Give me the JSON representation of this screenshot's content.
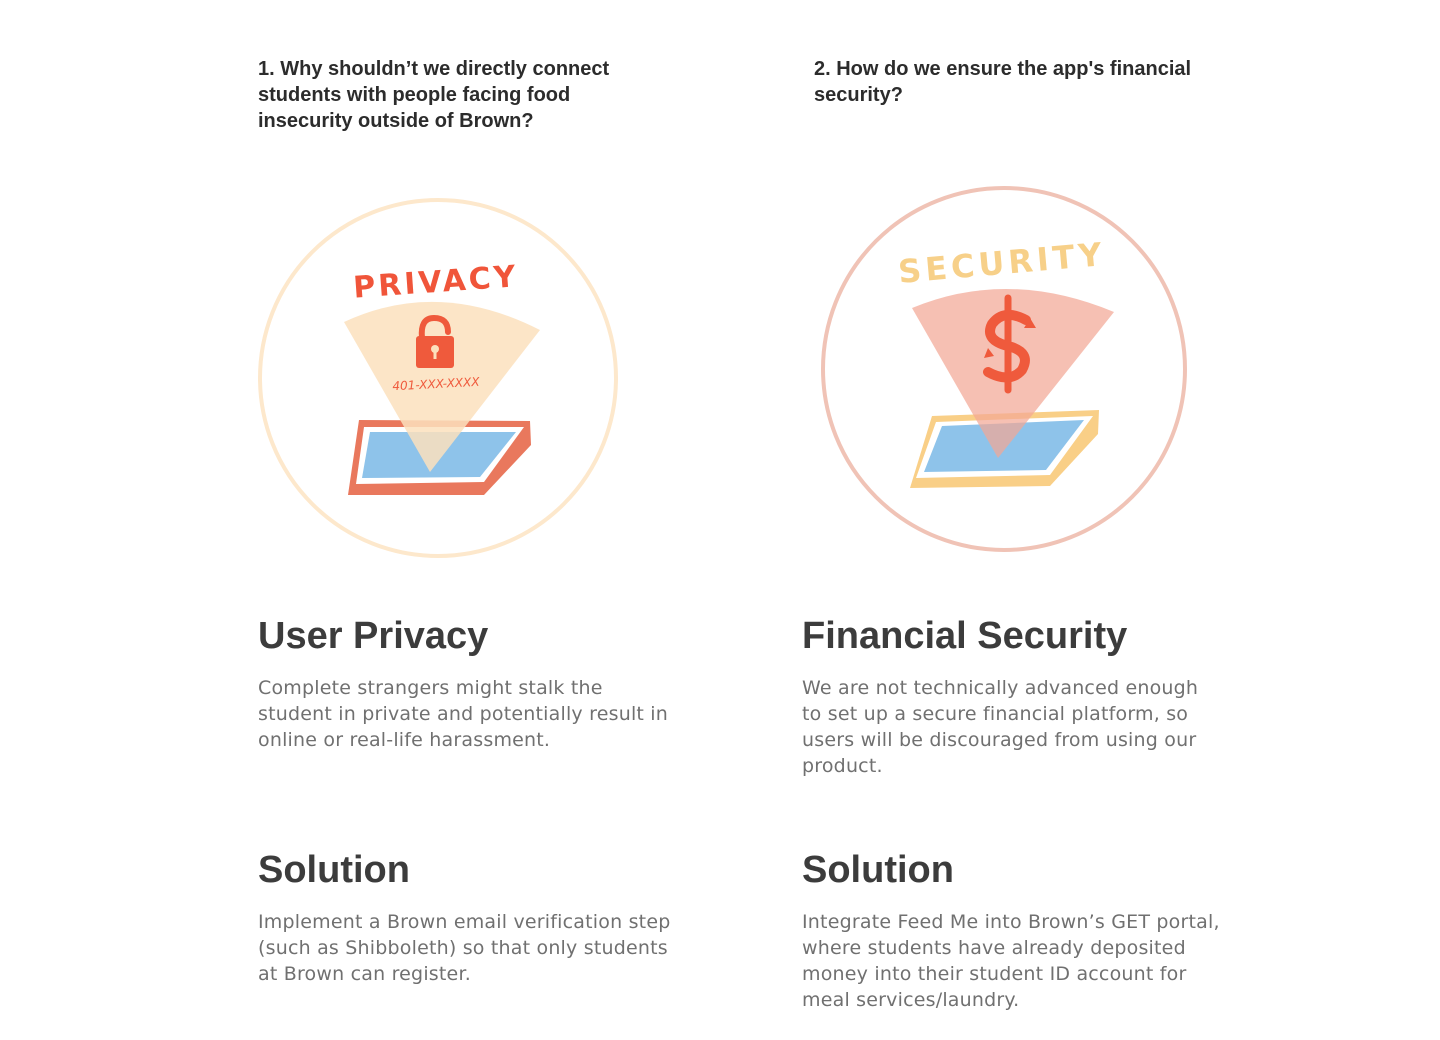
{
  "left": {
    "question": "1. Why shouldn’t we directly connect students with people facing food insecurity outside of Brown?",
    "illustration": {
      "label": "PRIVACY",
      "phone_text": "401-XXX-XXXX",
      "icon": "padlock-icon",
      "colors": {
        "ring": "#fde8cc",
        "label": "#f0553a",
        "beam": "#fce0bd",
        "icon": "#ef5a3c",
        "phone_frame": "#e9785d",
        "phone_screen": "#8ec3ea"
      }
    },
    "problem_title": "User Privacy",
    "problem_text": "Complete strangers might stalk the student in private and potentially result in online or real-life harassment.",
    "solution_title": "Solution",
    "solution_text": "Implement a Brown email verification step (such as Shibboleth) so that only students at Brown can register."
  },
  "right": {
    "question": "2. How do we ensure the app's financial security?",
    "illustration": {
      "label": "SECURITY",
      "icon": "dollar-icon",
      "colors": {
        "ring": "#f0c3b6",
        "label": "#f7d089",
        "beam": "#f3a795",
        "icon": "#ef5a3c",
        "phone_frame": "#f9cf87",
        "phone_screen": "#8ec3ea"
      }
    },
    "problem_title": "Financial Security",
    "problem_text": "We are not technically advanced enough to set up a secure financial platform, so users will be discouraged from using our product.",
    "solution_title": "Solution",
    "solution_text": "Integrate Feed Me into Brown’s GET portal, where students have already deposited money into their student ID account for meal services/laundry."
  }
}
